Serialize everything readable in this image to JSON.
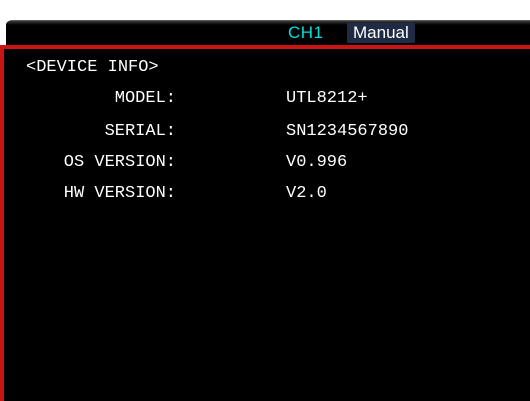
{
  "colors": {
    "text": "#ffffff",
    "channel_accent": "#00e0e0",
    "border_accent": "#cc1414",
    "background": "#000000"
  },
  "header": {
    "channel": "CH1",
    "mode": "Manual"
  },
  "panel": {
    "title": "<DEVICE INFO>",
    "rows": [
      {
        "label": "MODEL:",
        "value": "UTL8212+"
      },
      {
        "label": "SERIAL:",
        "value": "SN1234567890"
      },
      {
        "label": "OS VERSION:",
        "value": "V0.996"
      },
      {
        "label": "HW VERSION:",
        "value": "V2.0"
      }
    ]
  }
}
